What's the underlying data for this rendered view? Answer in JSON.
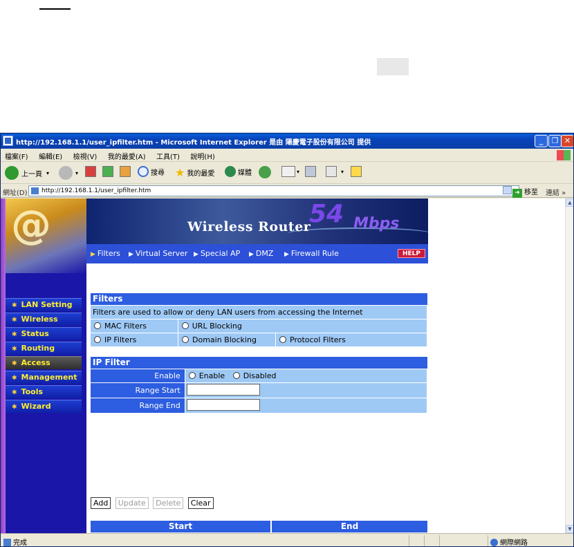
{
  "window": {
    "title": "http://192.168.1.1/user_ipfilter.htm - Microsoft Internet Explorer 是由 陽慶電子股份有限公司 提供",
    "minimize": "_",
    "maximize": "❐",
    "close": "✕"
  },
  "menu": [
    "檔案(F)",
    "編輯(E)",
    "檢視(V)",
    "我的最愛(A)",
    "工具(T)",
    "說明(H)"
  ],
  "toolbar": {
    "back": "上一頁",
    "search": "搜尋",
    "favorites": "我的最愛",
    "media": "媒體"
  },
  "address": {
    "label": "網址(D)",
    "url": "http://192.168.1.1/user_ipfilter.htm",
    "go": "移至",
    "links": "連結"
  },
  "sidebar": {
    "logo": "@",
    "items": [
      {
        "label": "LAN Setting"
      },
      {
        "label": "Wireless"
      },
      {
        "label": "Status"
      },
      {
        "label": "Routing"
      },
      {
        "label": "Access"
      },
      {
        "label": "Management"
      },
      {
        "label": "Tools"
      },
      {
        "label": "Wizard"
      }
    ],
    "active": "Access"
  },
  "banner": {
    "product": "Wireless Router",
    "speed": "54",
    "unit": "Mbps"
  },
  "tabs": [
    "Filters",
    "Virtual Server",
    "Special AP",
    "DMZ",
    "Firewall Rule"
  ],
  "help": "HELP",
  "filters": {
    "title": "Filters",
    "description": "Filters are used to allow or deny LAN users from accessing the Internet",
    "options": [
      "MAC Filters",
      "URL Blocking",
      "IP Filters",
      "Domain Blocking",
      "Protocol Filters"
    ]
  },
  "ipfilter": {
    "title": "IP Filter",
    "enable_label": "Enable",
    "enable_opt": "Enable",
    "disable_opt": "Disabled",
    "range_start_label": "Range Start",
    "range_end_label": "Range End",
    "range_start_value": "",
    "range_end_value": ""
  },
  "buttons": {
    "add": "Add",
    "update": "Update",
    "delete": "Delete",
    "clear": "Clear"
  },
  "table": {
    "headers": [
      "Start",
      "End"
    ]
  },
  "statusbar": {
    "left": "完成",
    "zone": "網際網路"
  },
  "colors": {
    "accent": "#2d5de0",
    "cell": "#9fc9f5",
    "sidebar": "#1a16a8",
    "nav_text": "#ffee33"
  }
}
